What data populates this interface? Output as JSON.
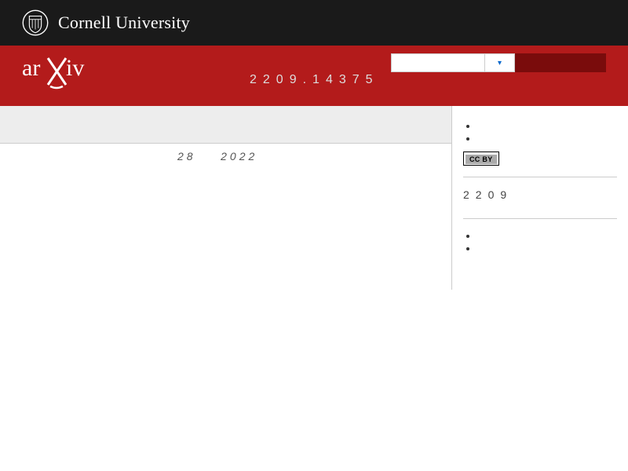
{
  "cornell": {
    "name": "Cornell University"
  },
  "arxiv": {
    "id_label": "2209.14375",
    "search_placeholder": "",
    "search_select": "",
    "search_btn": "",
    "help": "",
    "adv": ""
  },
  "breadcrumb": {
    "path": ""
  },
  "subheader": {
    "subject": "",
    "date_prefix": "28",
    "date_year": "2022"
  },
  "paper": {
    "title": "",
    "authors_prefix": "",
    "authors": [],
    "abstract_label": "",
    "abstract_body_1": "",
    "abstract_body_2": ""
  },
  "sidebar": {
    "download_title": "",
    "download_items": [
      "",
      ""
    ],
    "license": "CC BY",
    "browse_title": "",
    "cat_primary": "",
    "nav_new": "",
    "nav_recent": "",
    "nav_id": "2209",
    "cat_secondary": "",
    "change_browse": "",
    "refs_title": "",
    "refs_items": [
      "",
      ""
    ],
    "loading": ""
  }
}
